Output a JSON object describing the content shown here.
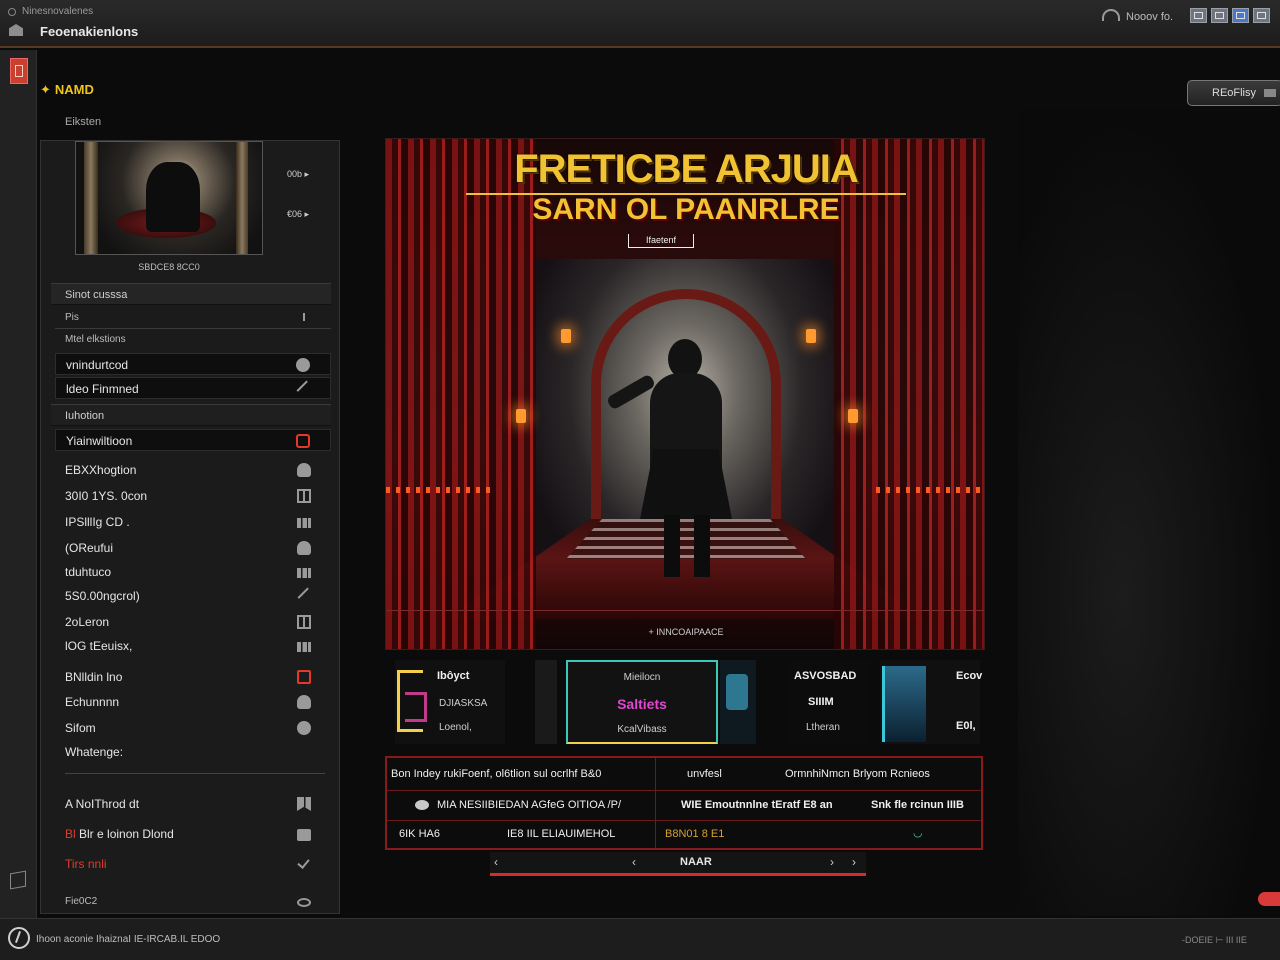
{
  "window": {
    "subtitle": "Ninesnovalenes",
    "title": "Feoenakienlons",
    "right_label": "Nooov fo."
  },
  "header": {
    "breadcrumb": "NAMD",
    "section_label": "Eiksten",
    "refresh_label": "REoFlisy"
  },
  "sidebar": {
    "thumb_side": [
      "00b ▸",
      "€06 ▸"
    ],
    "thumb_caption": "SBDCE8 8CC0",
    "group1": "Sinot cusssa",
    "small1": "Pis",
    "small2": "Mtel elkstions",
    "items_a": [
      {
        "label": "vnindurtcod",
        "icon": "disc-icon"
      },
      {
        "label": "ldeo Finmned",
        "icon": "pin-icon"
      }
    ],
    "group2": "Iuhotion",
    "items_b": [
      {
        "label": "Yiainwiltioon",
        "icon": "red-square-icon"
      },
      {
        "label": "EBXXhogtion",
        "icon": "controller-icon"
      },
      {
        "label": "30I0 1YS. 0con",
        "icon": "monitor-icon"
      },
      {
        "label": "IPSlllIg CD .",
        "icon": "image-icon"
      },
      {
        "label": "(OReufui",
        "icon": "headset-icon"
      },
      {
        "label": "tduhtuco",
        "icon": "bars-icon"
      },
      {
        "label": "5S0.00ngcrol)",
        "icon": "chart-icon"
      },
      {
        "label": "2oLeron",
        "icon": "grid-icon"
      },
      {
        "label": "lOG tEeuisx,",
        "icon": "waves-icon"
      },
      {
        "label": "BNlldin lno",
        "icon": "red-m-icon"
      },
      {
        "label": "Echunnnn",
        "icon": "person-icon"
      },
      {
        "label": "Sifom",
        "icon": "user-circle-icon"
      },
      {
        "label": "Whatenge:",
        "icon": ""
      }
    ],
    "items_c": [
      {
        "label": "A NoIThrod dt",
        "icon": "flag-icon",
        "red": ""
      },
      {
        "label": "Blr e loinon Dlond",
        "icon": "bag-icon",
        "red": "Bl"
      },
      {
        "label": "Tirs  nnli",
        "icon": "check-icon",
        "red": "Tirs  nnli"
      }
    ],
    "footer": "Fie0C2"
  },
  "poster": {
    "title": "FRETICBE ARJUIA",
    "subtitle": "SARN OL PAANRLRE",
    "tag": "Ifaetenf",
    "caption": "+ INNCOAIPAACE"
  },
  "cards": {
    "c1": {
      "title": "Ibôyct",
      "line2": "DJIASKSA",
      "line3": "Loenol,"
    },
    "c3": {
      "title": "Mieilocn",
      "highlight": "Saltiets",
      "line3": "KcalVibass"
    },
    "c5": {
      "title": "ASVOSBAD",
      "line2": "SIIIM",
      "line3": "Ltheran"
    },
    "c6": {
      "title": "Ecov",
      "line2": "E0l,"
    }
  },
  "info": {
    "r1c1": "Bon Indey rukiFoenf, ol6tlion sul ocrlhf B&0",
    "r1c2": "unvfesl",
    "r1c3": "OrmnhiNmcn Brlyom  Rcnieos",
    "r2c1": "MIA NESIIBIEDAN AGfeG OITIOA /P/",
    "r2c2": "WIE Emoutnnlne  tEratf E8 an",
    "r2c3": "Snk fle rcinun IIIB",
    "r3c1a": "6IK HA6",
    "r3c1b": "IE8 IIL ELIAUIMEHOL",
    "r3c2": "B8N01 8  E1"
  },
  "pager": {
    "label": "NAAR"
  },
  "statusbar": {
    "text": "Ihoon aconie IhaiznaI IE-IRCAB.IL EDOO",
    "right": "-DOEIE ⊢ III IIE"
  }
}
